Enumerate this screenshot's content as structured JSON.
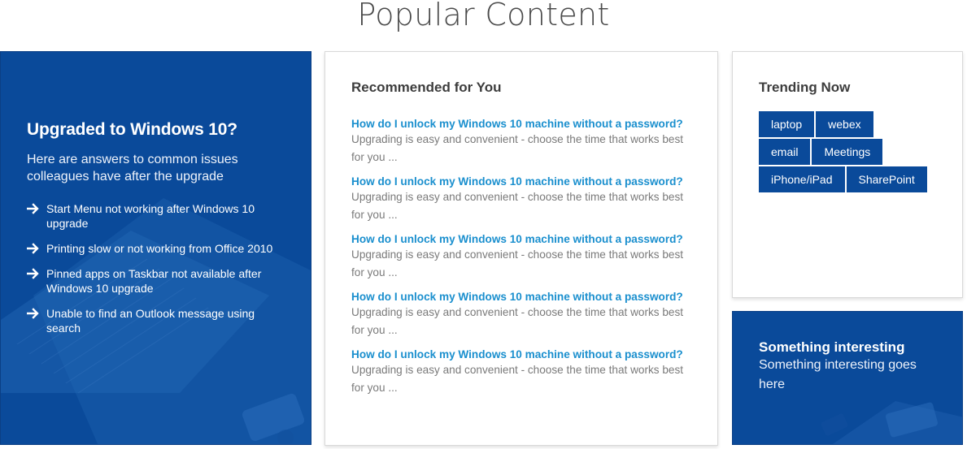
{
  "page": {
    "title": "Popular Content"
  },
  "promo": {
    "heading": "Upgraded to Windows 10?",
    "subtext": "Here are answers to common issues colleagues have after the upgrade",
    "items": [
      "Start Menu not working after Windows 10 upgrade",
      "Printing slow or not working from Office 2010",
      "Pinned apps on Taskbar not available after Windows 10 upgrade",
      "Unable to find an Outlook message using search"
    ],
    "icon": "arrow-right-icon",
    "background_color": "#0a4a9a"
  },
  "recommended": {
    "heading": "Recommended for You",
    "items": [
      {
        "title": "How do I unlock my Windows 10 machine without a password?",
        "description": "Upgrading is easy and convenient - choose the time that works best for you ..."
      },
      {
        "title": "How do I unlock my Windows 10 machine without a password?",
        "description": "Upgrading is easy and convenient - choose the time that works best for you ..."
      },
      {
        "title": "How do I unlock my Windows 10 machine without a password?",
        "description": "Upgrading is easy and convenient - choose the time that works best for you ..."
      },
      {
        "title": "How do I unlock my Windows 10 machine without a password?",
        "description": "Upgrading is easy and convenient - choose the time that works best for you ..."
      },
      {
        "title": "How do I unlock my Windows 10 machine without a password?",
        "description": "Upgrading is easy and convenient - choose the time that works best for you ..."
      }
    ],
    "link_color": "#1a8fce"
  },
  "trending": {
    "heading": "Trending Now",
    "tags": [
      [
        "laptop",
        "webex"
      ],
      [
        "email",
        "Meetings"
      ],
      [
        "iPhone/iPad",
        "SharePoint"
      ]
    ],
    "tag_color": "#0a4a9a"
  },
  "interesting": {
    "title": "Something interesting",
    "text": "Something interesting goes here"
  }
}
